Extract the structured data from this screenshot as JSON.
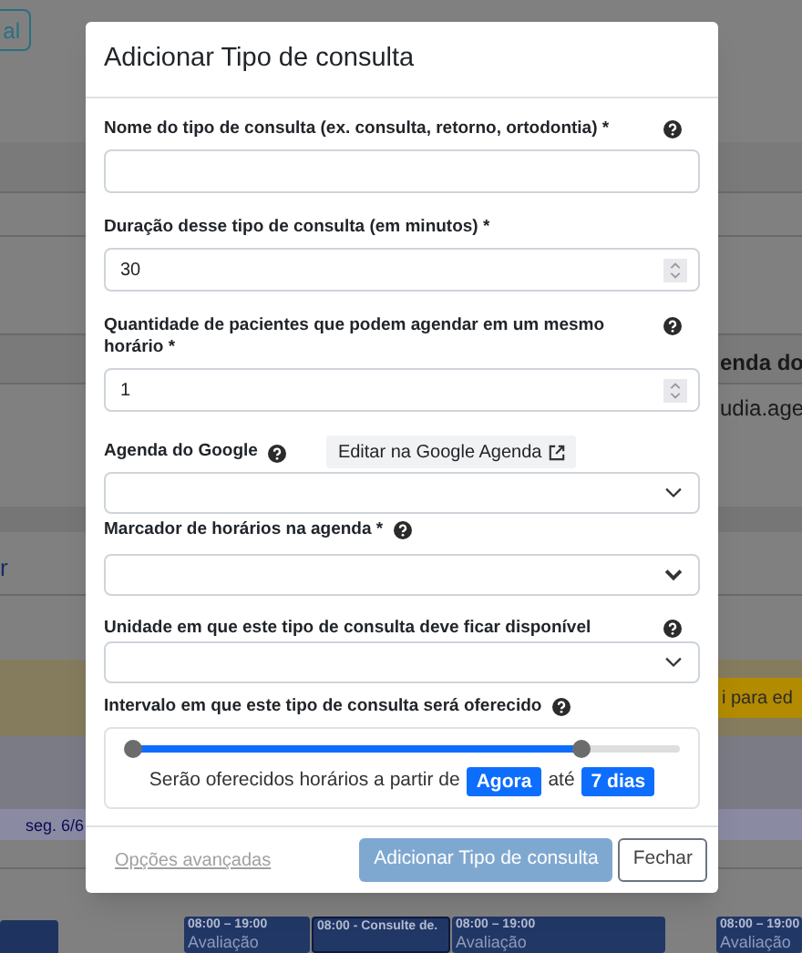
{
  "background": {
    "button": "al",
    "column_header": "enda do",
    "cell": "udia.age",
    "link": "r",
    "notice": "i para ed",
    "day_label": "seg. 6/6",
    "events": [
      {
        "time": "08:00 – 19:00",
        "title": "Avaliação"
      },
      {
        "time": "08:00 - Consulte de."
      },
      {
        "time": "08:00 – 19:00",
        "title": "Avaliação"
      },
      {
        "time": "08:00 – 19:00",
        "title": "Avaliação"
      }
    ]
  },
  "modal": {
    "title": "Adicionar Tipo de consulta",
    "fields": [
      {
        "kind": "text",
        "label": "Nome do tipo de consulta (ex. consulta, retorno, ortodontia) *",
        "help": true
      },
      {
        "kind": "number",
        "label": "Duração desse tipo de consulta (em minutos) *",
        "help": false,
        "value": "30"
      },
      {
        "kind": "number",
        "label": "Quantidade de pacientes que podem agendar em um mesmo horário *",
        "help": true,
        "value": "1"
      },
      {
        "kind": "select",
        "label": "Agenda do Google",
        "help": true,
        "link_button": "Editar na Google Agenda"
      },
      {
        "kind": "select",
        "label": "Marcador de horários na agenda *",
        "help": true
      },
      {
        "kind": "select",
        "label": "Unidade em que este tipo de consulta deve ficar disponível",
        "help": true
      },
      {
        "kind": "range",
        "label": "Intervalo em que este tipo de consulta será oferecido",
        "help": true,
        "level": 0.82,
        "sentence_start": "Serão oferecidos horários a partir de",
        "from": "Agora",
        "joiner": "até",
        "to": "7 dias"
      }
    ],
    "footer": {
      "link": "Opções avançadas",
      "primary": {
        "label": "Adicionar Tipo de consulta",
        "disabled": true
      },
      "close": "Fechar"
    }
  }
}
